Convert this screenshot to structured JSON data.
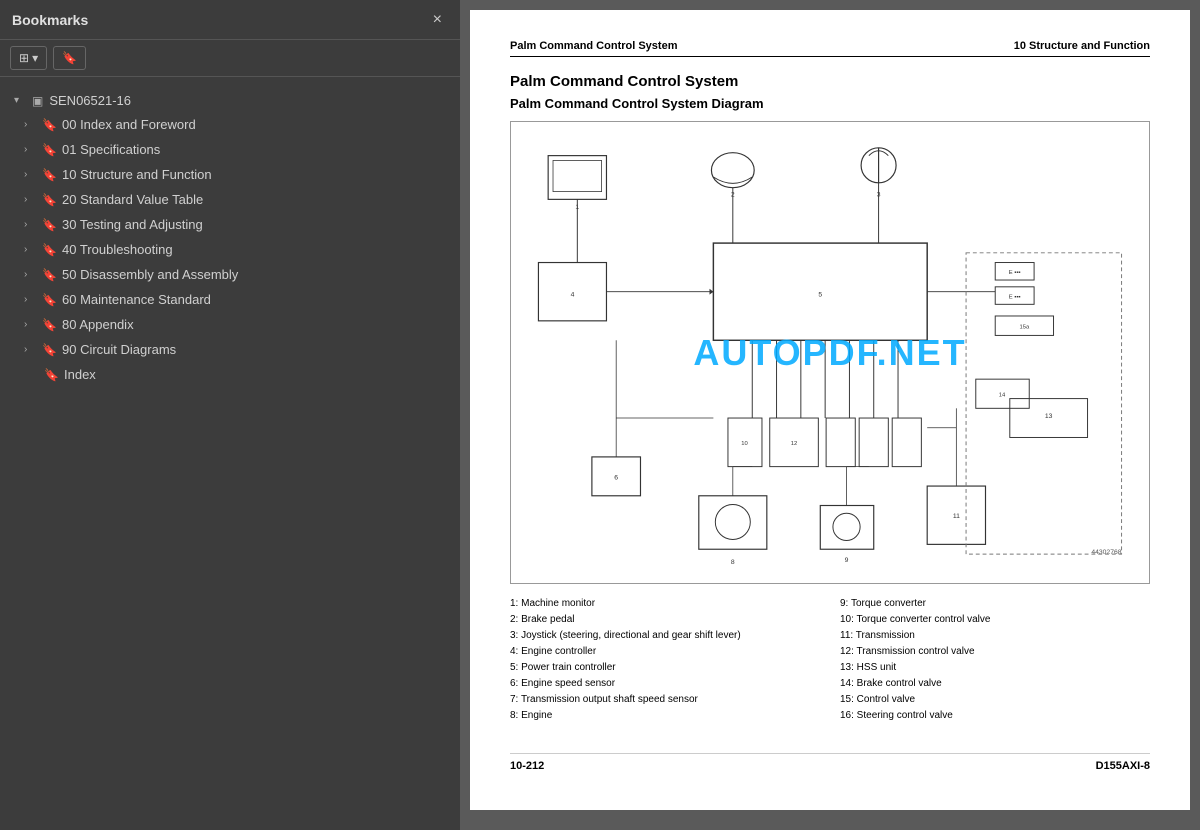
{
  "sidebar": {
    "title": "Bookmarks",
    "close_label": "×",
    "toolbar": {
      "expand_icon": "⊞",
      "expand_label": "▾",
      "bookmark_icon": "🔖"
    },
    "root": {
      "label": "SEN06521-16",
      "expanded": true
    },
    "items": [
      {
        "id": "item-00",
        "label": "00 Index and Foreword",
        "has_children": true,
        "expanded": false
      },
      {
        "id": "item-01",
        "label": "01 Specifications",
        "has_children": true,
        "expanded": false
      },
      {
        "id": "item-10",
        "label": "10 Structure and Function",
        "has_children": true,
        "expanded": false
      },
      {
        "id": "item-20",
        "label": "20 Standard Value Table",
        "has_children": true,
        "expanded": false
      },
      {
        "id": "item-30",
        "label": "30 Testing and Adjusting",
        "has_children": true,
        "expanded": false
      },
      {
        "id": "item-40",
        "label": "40 Troubleshooting",
        "has_children": true,
        "expanded": false
      },
      {
        "id": "item-50",
        "label": "50 Disassembly and Assembly",
        "has_children": true,
        "expanded": false
      },
      {
        "id": "item-60",
        "label": "60 Maintenance Standard",
        "has_children": true,
        "expanded": false
      },
      {
        "id": "item-80",
        "label": "80 Appendix",
        "has_children": true,
        "expanded": false
      },
      {
        "id": "item-90",
        "label": "90 Circuit Diagrams",
        "has_children": true,
        "expanded": false
      },
      {
        "id": "item-index",
        "label": "Index",
        "has_children": false,
        "expanded": false
      }
    ]
  },
  "document": {
    "header_left": "Palm Command Control System",
    "header_right": "10 Structure and Function",
    "main_title": "Palm Command Control System",
    "sub_title": "Palm Command Control System Diagram",
    "watermark": "AUTOPDF.NET",
    "diagram_ref": "44302768",
    "legend": [
      {
        "num": "1",
        "text": "1: Machine monitor"
      },
      {
        "num": "2",
        "text": "2: Brake pedal"
      },
      {
        "num": "3",
        "text": "3: Joystick (steering, directional and gear shift lever)"
      },
      {
        "num": "4",
        "text": "4: Engine controller"
      },
      {
        "num": "5",
        "text": "5: Power train controller"
      },
      {
        "num": "6",
        "text": "6: Engine speed sensor"
      },
      {
        "num": "7",
        "text": "7: Transmission output shaft speed sensor"
      },
      {
        "num": "8",
        "text": "8: Engine"
      },
      {
        "num": "9",
        "text": "9: Torque converter"
      },
      {
        "num": "10",
        "text": "10: Torque converter control valve"
      },
      {
        "num": "11",
        "text": "11: Transmission"
      },
      {
        "num": "12",
        "text": "12: Transmission control valve"
      },
      {
        "num": "13",
        "text": "13: HSS unit"
      },
      {
        "num": "14",
        "text": "14: Brake control valve"
      },
      {
        "num": "15",
        "text": "15: Control valve"
      },
      {
        "num": "16",
        "text": "16: Steering control valve"
      }
    ],
    "footer_left": "10-212",
    "footer_right": "D155AXI-8"
  }
}
